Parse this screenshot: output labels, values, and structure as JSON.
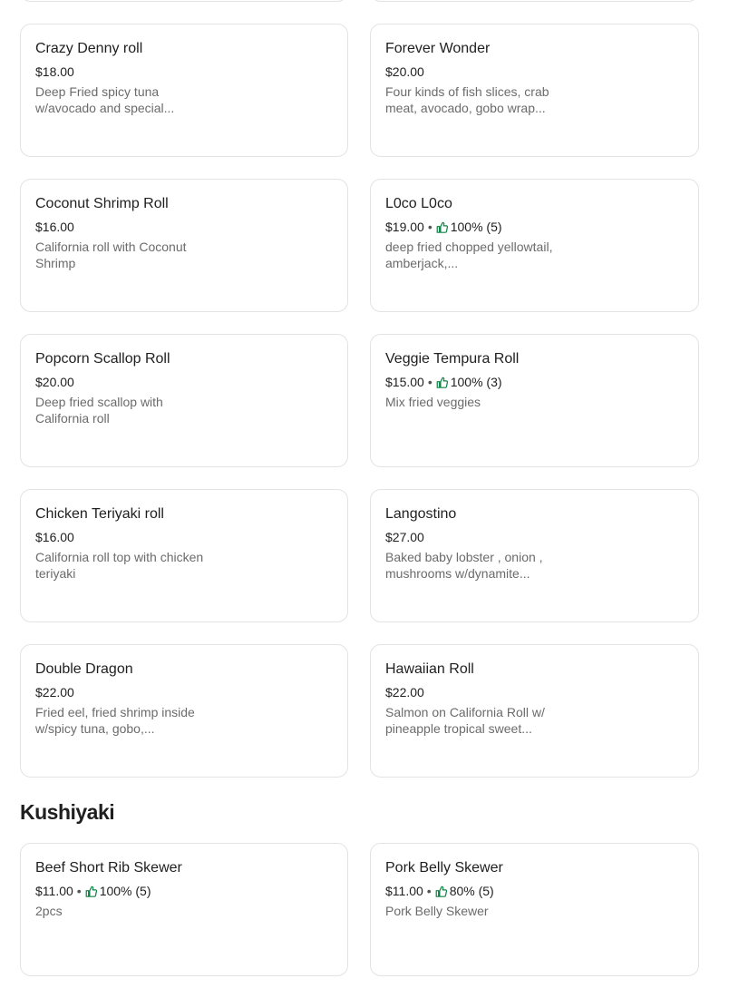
{
  "section_title": "Kushiyaki",
  "colors": {
    "border": "#e3e3e3",
    "text": "#1f1f1f",
    "muted": "#6b6b6b",
    "rating_icon": "#0e8345"
  },
  "items": [
    {
      "name": "Crazy Denny roll",
      "price": "$18.00",
      "description": "Deep Fried spicy tuna w/avocado and special..."
    },
    {
      "name": "Forever Wonder",
      "price": "$20.00",
      "description": "Four kinds of fish slices, crab meat, avocado, gobo wrap..."
    },
    {
      "name": "Coconut Shrimp Roll",
      "price": "$16.00",
      "description": "California roll with Coconut Shrimp"
    },
    {
      "name": "L0co L0co",
      "price": "$19.00",
      "rating": "100% (5)",
      "description": "deep fried chopped yellowtail, amberjack,..."
    },
    {
      "name": "Popcorn Scallop Roll",
      "price": "$20.00",
      "description": "Deep fried scallop with California roll"
    },
    {
      "name": "Veggie Tempura Roll",
      "price": "$15.00",
      "rating": "100% (3)",
      "description": "Mix fried veggies"
    },
    {
      "name": "Chicken Teriyaki roll",
      "price": "$16.00",
      "description": "California roll top with chicken teriyaki"
    },
    {
      "name": "Langostino",
      "price": "$27.00",
      "description": "Baked baby lobster , onion , mushrooms w/dynamite..."
    },
    {
      "name": "Double Dragon",
      "price": "$22.00",
      "description": "Fried eel, fried shrimp inside w/spicy tuna, gobo,..."
    },
    {
      "name": "Hawaiian Roll",
      "price": "$22.00",
      "description": "Salmon on California Roll w/ pineapple tropical sweet..."
    },
    {
      "name": "Beef Short Rib Skewer",
      "price": "$11.00",
      "rating": "100% (5)",
      "description": "2pcs"
    },
    {
      "name": "Pork Belly Skewer",
      "price": "$11.00",
      "rating": "80% (5)",
      "description": "Pork Belly Skewer"
    }
  ]
}
